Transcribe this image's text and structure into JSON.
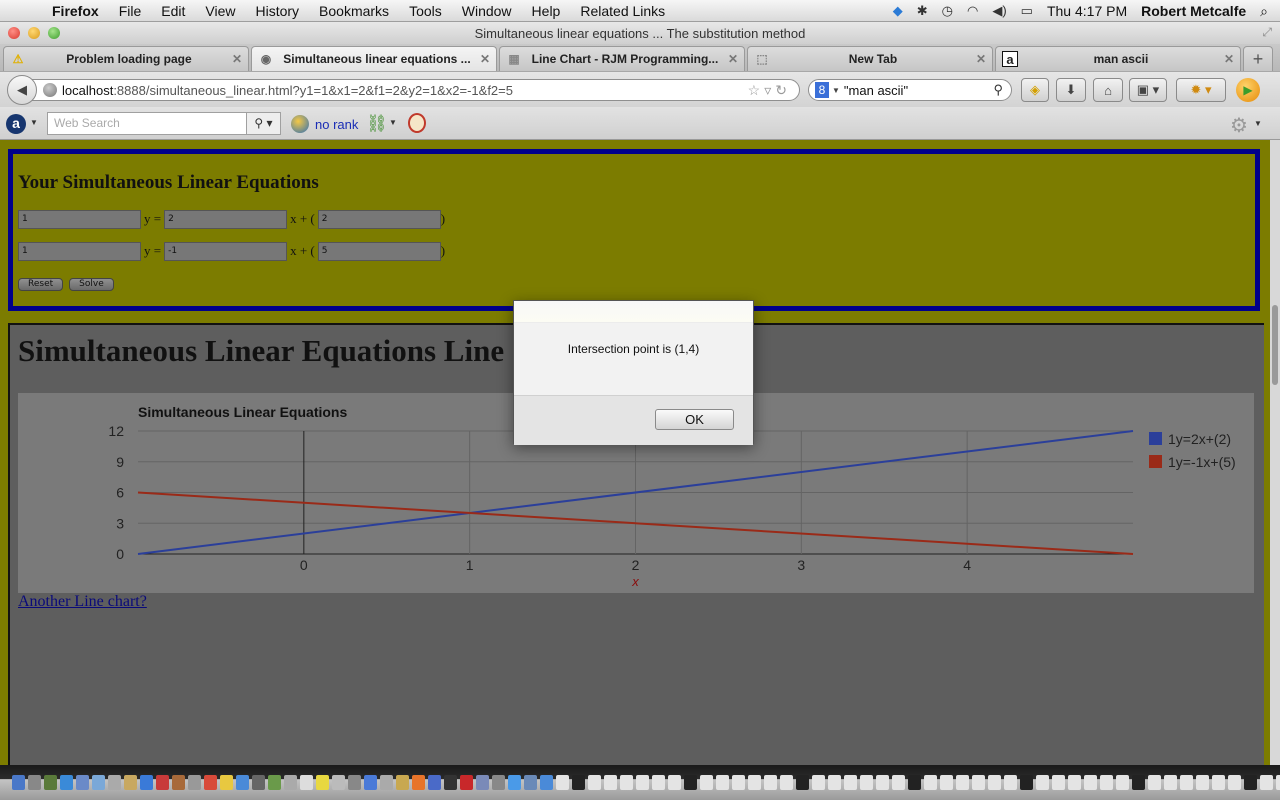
{
  "menubar": {
    "app": "Firefox",
    "items": [
      "File",
      "Edit",
      "View",
      "History",
      "Bookmarks",
      "Tools",
      "Window",
      "Help",
      "Related Links"
    ],
    "status_icons": [
      "dropbox-icon",
      "bluetooth-icon",
      "time-machine-icon",
      "wifi-icon",
      "volume-icon",
      "battery-icon"
    ],
    "clock": "Thu 4:17 PM",
    "user": "Robert Metcalfe",
    "spotlight": "⌕"
  },
  "window": {
    "title": "Simultaneous linear equations ... The substitution method"
  },
  "tabs": [
    {
      "label": "Problem loading page",
      "icon": "warning-icon",
      "active": false
    },
    {
      "label": "Simultaneous linear equations ...",
      "icon": "globe-icon",
      "active": true
    },
    {
      "label": "Line Chart - RJM Programming...",
      "icon": "page-thumbnail-icon",
      "active": false
    },
    {
      "label": "New Tab",
      "icon": "blank-tab-icon",
      "active": false
    },
    {
      "label": "man ascii",
      "icon": "letter-a-icon",
      "active": false
    }
  ],
  "navbar": {
    "url_host": "localhost",
    "url_rest": ":8888/simultaneous_linear.html?y1=1&x1=2&f1=2&y2=1&x2=-1&f2=5",
    "search_value": "\"man ascii\"",
    "search_engine": "8"
  },
  "addonbar": {
    "websearch_placeholder": "Web Search",
    "rank_text": "no rank"
  },
  "equations": {
    "title": "Your Simultaneous Linear Equations",
    "rows": [
      {
        "y": "1",
        "x": "2",
        "f": "2"
      },
      {
        "y": "1",
        "x": "-1",
        "f": "5"
      }
    ],
    "sep_y": "y =",
    "sep_x": "x + (",
    "sep_close": ")",
    "reset_label": "Reset",
    "solve_label": "Solve"
  },
  "chart_section": {
    "heading": "Simultaneous Linear Equations Line Chart",
    "link_text": "Another Line chart?"
  },
  "alert": {
    "message": "Intersection point is (1,4)",
    "ok_label": "OK"
  },
  "chart_data": {
    "type": "line",
    "title": "Simultaneous Linear Equations",
    "xlabel": "x",
    "ylabel": "",
    "x": [
      -1,
      5
    ],
    "xlim": [
      -1,
      5
    ],
    "ylim": [
      0,
      12
    ],
    "xticks": [
      "0",
      "1",
      "2",
      "3",
      "4"
    ],
    "xtick_values": [
      0,
      1,
      2,
      3,
      4
    ],
    "yticks": [
      "0",
      "3",
      "6",
      "9",
      "12"
    ],
    "ytick_values": [
      0,
      3,
      6,
      9,
      12
    ],
    "grid": true,
    "legend_position": "right",
    "series": [
      {
        "name": "1y=2x+(2)",
        "color": "#2b3f9a",
        "values": [
          0,
          12
        ]
      },
      {
        "name": "1y=-1x+(5)",
        "color": "#9a2a18",
        "values": [
          6,
          0
        ]
      }
    ]
  }
}
